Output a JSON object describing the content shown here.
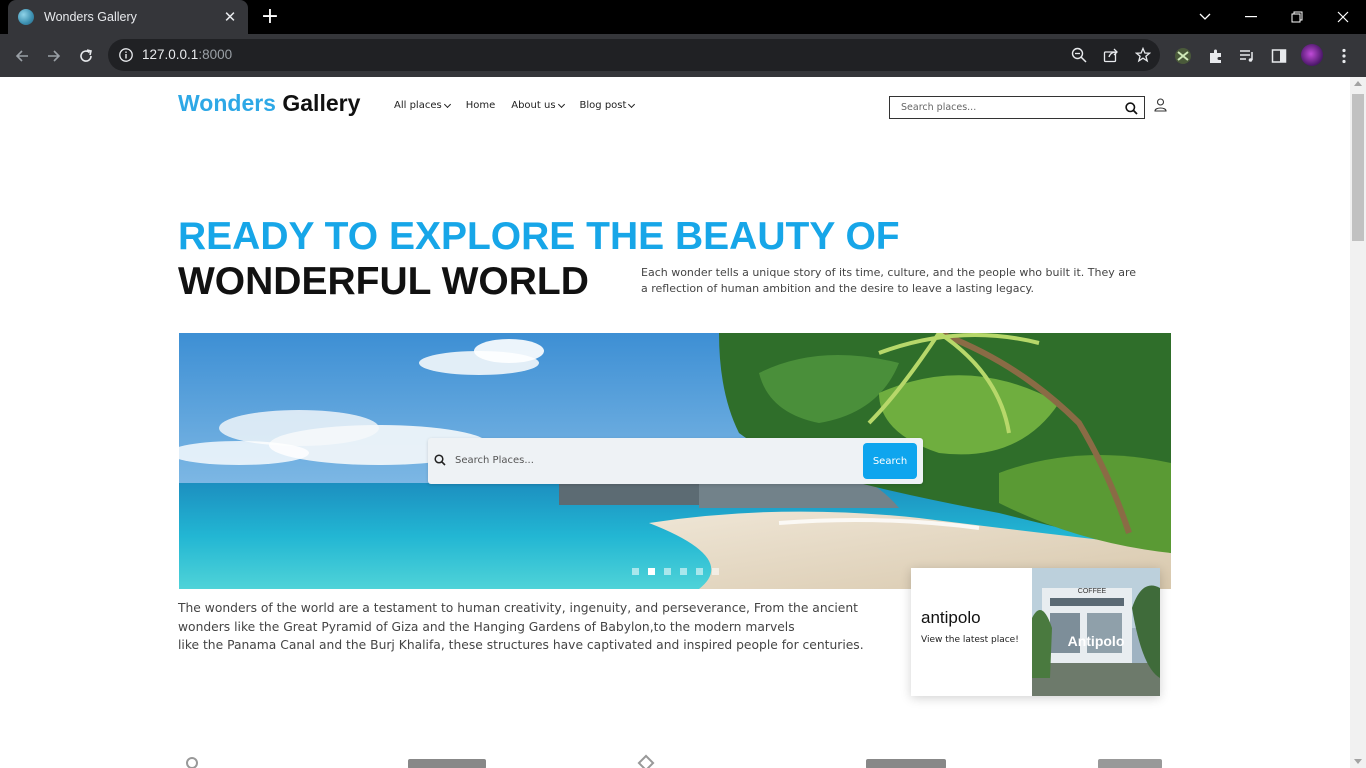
{
  "browser": {
    "tab_title": "Wonders Gallery",
    "tab_close": "✕",
    "new_tab": "+",
    "url_host": "127.0.0.1",
    "url_port": ":8000"
  },
  "site": {
    "logo_blue": "Wonders",
    "logo_black": " Gallery",
    "nav": [
      {
        "label": "All places",
        "dropdown": true
      },
      {
        "label": "Home",
        "dropdown": false
      },
      {
        "label": "About us",
        "dropdown": true
      },
      {
        "label": "Blog post",
        "dropdown": true
      }
    ],
    "search_placeholder": "Search places..."
  },
  "hero": {
    "line1": "READY TO EXPLORE THE BEAUTY OF",
    "line2": "WONDERFUL WORLD",
    "description": "Each wonder tells a unique story of its time, culture, and the people who built it. They are a reflection of human ambition and the desire to leave a lasting legacy."
  },
  "banner": {
    "search_placeholder": "Search Places...",
    "search_button": "Search",
    "slide_count": 6,
    "active_slide": 2
  },
  "body": {
    "lines": [
      "The wonders of the world are a testament to human creativity, ingenuity, and perseverance, From the ancient",
      "wonders like the Great Pyramid of Giza and the Hanging Gardens of Babylon,to the modern marvels",
      "like the Panama Canal and the Burj Khalifa, these structures have captivated and inspired people for centuries."
    ]
  },
  "latest": {
    "title": "antipolo",
    "subtitle": "View the latest place!",
    "image_caption": "Antipolo",
    "image_sign": "COFFEE"
  },
  "colors": {
    "brand_blue": "#17a6e8",
    "button_blue": "#0ea5ee",
    "chrome_dark": "#35363a"
  }
}
